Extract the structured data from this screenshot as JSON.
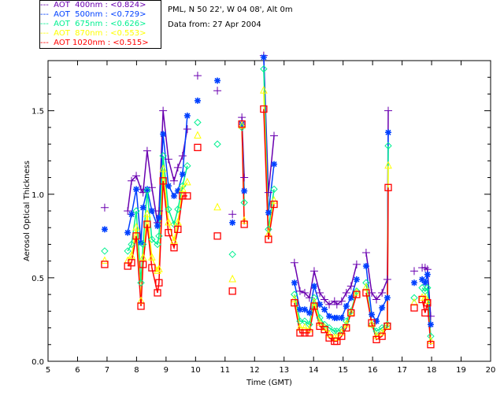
{
  "header": {
    "location": "PML, N 50 22', W 04 08', Alt 0m",
    "date": "Data from: 27 Apr 2004"
  },
  "chart_data": {
    "type": "line",
    "xlabel": "Time (GMT)",
    "ylabel": "Aerosol Optical Thickness",
    "xlim": [
      5,
      20
    ],
    "ylim": [
      0,
      1.8
    ],
    "xticks": [
      "5",
      "6",
      "7",
      "8",
      "9",
      "10",
      "11",
      "12",
      "13",
      "14",
      "15",
      "16",
      "17",
      "18",
      "19",
      "20"
    ],
    "yticks": [
      "0.0",
      "0.5",
      "1.0",
      "1.5"
    ],
    "legend_position": "top-left, outside",
    "segments": [
      {
        "x": [
          6.92
        ],
        "values": {
          "400": [
            0.92
          ],
          "500": [
            0.79
          ],
          "675": [
            0.66
          ],
          "870": [
            0.6
          ],
          "1020": [
            0.58
          ]
        }
      },
      {
        "x": [
          7.7,
          7.83,
          7.99,
          8.15,
          8.22,
          8.36,
          8.52,
          8.71,
          8.76,
          8.9,
          9.08,
          9.27,
          9.4,
          9.56,
          9.72
        ],
        "values": {
          "400": [
            0.9,
            1.08,
            1.11,
            1.03,
            1.01,
            1.26,
            1.04,
            0.83,
            0.9,
            1.5,
            1.21,
            1.08,
            1.16,
            1.23,
            1.39
          ],
          "500": [
            0.77,
            0.88,
            1.03,
            0.71,
            0.92,
            1.03,
            0.9,
            0.81,
            0.86,
            1.36,
            1.05,
            0.99,
            1.02,
            1.12,
            1.47
          ],
          "675": [
            0.66,
            0.7,
            0.9,
            0.47,
            0.7,
            1.02,
            0.73,
            0.7,
            0.75,
            1.23,
            0.91,
            0.82,
            0.91,
            1.05,
            1.17
          ],
          "870": [
            0.6,
            0.63,
            0.8,
            0.36,
            0.62,
            0.88,
            0.62,
            0.54,
            0.55,
            1.15,
            0.83,
            0.72,
            0.83,
            1.03,
            1.07
          ],
          "1020": [
            0.57,
            0.59,
            0.75,
            0.33,
            0.58,
            0.82,
            0.56,
            0.41,
            0.47,
            1.08,
            0.77,
            0.68,
            0.79,
            0.99,
            0.99
          ]
        }
      },
      {
        "x": [
          10.07
        ],
        "values": {
          "400": [
            1.71
          ],
          "500": [
            1.56
          ],
          "675": [
            1.43
          ],
          "870": [
            1.35
          ],
          "1020": [
            1.28
          ]
        }
      },
      {
        "x": [
          10.74
        ],
        "values": {
          "400": [
            1.62
          ],
          "500": [
            1.68
          ],
          "675": [
            1.3
          ],
          "870": [
            0.92
          ],
          "1020": [
            0.75
          ]
        }
      },
      {
        "x": [
          11.25
        ],
        "values": {
          "400": [
            0.88
          ],
          "500": [
            0.83
          ],
          "675": [
            0.64
          ],
          "870": [
            0.49
          ],
          "1020": [
            0.42
          ]
        }
      },
      {
        "x": [
          11.57,
          11.65
        ],
        "values": {
          "400": [
            1.46,
            1.1
          ],
          "500": [
            1.42,
            1.02
          ],
          "675": [
            1.4,
            0.95
          ],
          "870": [
            1.41,
            0.84
          ],
          "1020": [
            1.42,
            0.82
          ]
        }
      },
      {
        "x": [
          12.31,
          12.47,
          12.66
        ],
        "values": {
          "400": [
            1.83,
            1.01,
            1.35
          ],
          "500": [
            1.82,
            0.89,
            1.18
          ],
          "675": [
            1.75,
            0.79,
            1.03
          ],
          "870": [
            1.62,
            0.76,
            0.96
          ],
          "1020": [
            1.51,
            0.73,
            0.94
          ]
        }
      },
      {
        "x": [
          13.35,
          13.54,
          13.7,
          13.86,
          14.02,
          14.21,
          14.37,
          14.53,
          14.71,
          14.79,
          14.95,
          15.11,
          15.27,
          15.46
        ],
        "values": {
          "400": [
            0.59,
            0.42,
            0.41,
            0.38,
            0.54,
            0.41,
            0.37,
            0.34,
            0.36,
            0.34,
            0.36,
            0.41,
            0.45,
            0.58
          ],
          "500": [
            0.47,
            0.31,
            0.31,
            0.29,
            0.45,
            0.34,
            0.31,
            0.27,
            0.26,
            0.26,
            0.26,
            0.33,
            0.38,
            0.49
          ],
          "675": [
            0.4,
            0.24,
            0.24,
            0.22,
            0.38,
            0.26,
            0.22,
            0.2,
            0.18,
            0.18,
            0.19,
            0.24,
            0.3,
            0.42
          ],
          "870": [
            0.37,
            0.2,
            0.2,
            0.19,
            0.35,
            0.23,
            0.2,
            0.16,
            0.14,
            0.14,
            0.17,
            0.22,
            0.29,
            0.41
          ],
          "1020": [
            0.35,
            0.17,
            0.17,
            0.17,
            0.33,
            0.21,
            0.19,
            0.14,
            0.12,
            0.12,
            0.15,
            0.2,
            0.29,
            0.4
          ]
        }
      },
      {
        "x": [
          15.78,
          15.97,
          16.13,
          16.32,
          16.5,
          16.53
        ],
        "values": {
          "400": [
            0.65,
            0.41,
            0.37,
            0.41,
            0.49,
            1.5
          ],
          "500": [
            0.57,
            0.28,
            0.24,
            0.32,
            0.38,
            1.37
          ],
          "675": [
            0.47,
            0.22,
            0.18,
            0.2,
            0.22,
            1.29
          ],
          "870": [
            0.44,
            0.22,
            0.15,
            0.17,
            0.21,
            1.17
          ],
          "1020": [
            0.41,
            0.23,
            0.13,
            0.15,
            0.21,
            1.04
          ]
        }
      },
      {
        "x": [
          17.41
        ],
        "values": {
          "400": [
            0.54
          ],
          "500": [
            0.47
          ],
          "675": [
            0.38
          ],
          "870": [
            0.35
          ],
          "1020": [
            0.32
          ]
        }
      },
      {
        "x": [
          17.68,
          17.78,
          17.86,
          17.97
        ],
        "values": {
          "400": [
            0.56,
            0.56,
            0.55,
            0.27
          ],
          "500": [
            0.49,
            0.47,
            0.52,
            0.22
          ],
          "675": [
            0.44,
            0.42,
            0.44,
            0.15
          ],
          "870": [
            0.38,
            0.38,
            0.36,
            0.12
          ],
          "1020": [
            0.37,
            0.29,
            0.35,
            0.1
          ]
        }
      }
    ],
    "series": [
      {
        "key": "400",
        "name": "AOT  400nm : <0.824>",
        "color": "#6a00b0",
        "marker": "plus"
      },
      {
        "key": "500",
        "name": "AOT  500nm : <0.729>",
        "color": "#0040ff",
        "marker": "asterisk"
      },
      {
        "key": "675",
        "name": "AOT  675nm : <0.626>",
        "color": "#00f090",
        "marker": "diamond"
      },
      {
        "key": "870",
        "name": "AOT  870nm : <0.553>",
        "color": "#ffff00",
        "marker": "triangle"
      },
      {
        "key": "1020",
        "name": "AOT 1020nm : <0.515>",
        "color": "#ff0000",
        "marker": "square"
      }
    ]
  }
}
